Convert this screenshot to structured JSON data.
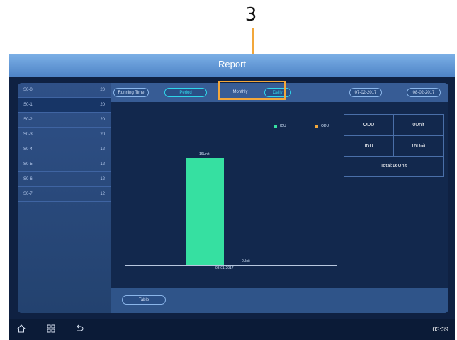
{
  "annotation": {
    "number": "3"
  },
  "header": {
    "title": "Report"
  },
  "sidebar": {
    "items": [
      {
        "name": "S0-0",
        "count": "20",
        "active": false
      },
      {
        "name": "S0-1",
        "count": "20",
        "active": true
      },
      {
        "name": "S0-2",
        "count": "20",
        "active": false
      },
      {
        "name": "S0-3",
        "count": "20",
        "active": false
      },
      {
        "name": "S0-4",
        "count": "12",
        "active": false
      },
      {
        "name": "S0-5",
        "count": "12",
        "active": false
      },
      {
        "name": "S0-6",
        "count": "12",
        "active": false
      },
      {
        "name": "S0-7",
        "count": "12",
        "active": false
      }
    ]
  },
  "filters": {
    "running_time_label": "Running Time",
    "period_value": "Period",
    "monthly_label": "Monthly",
    "monthly_value": "Daily",
    "start_date": "07-02-2017",
    "separator": "~",
    "end_date": "08-02-2017"
  },
  "chart_data": {
    "type": "bar",
    "categories": [
      "08-01-2017"
    ],
    "series": [
      {
        "name": "IDU",
        "values": [
          16
        ],
        "color": "#36e0a1"
      },
      {
        "name": "ODU",
        "values": [
          0
        ],
        "color": "#f2a73b"
      }
    ],
    "data_labels": [
      "16Unit",
      "0Unit"
    ],
    "ylim": [
      0,
      18
    ],
    "legend_position": "top-right"
  },
  "summary": {
    "odu_label": "ODU",
    "odu_value": "0Unit",
    "idu_label": "IDU",
    "idu_value": "16Unit",
    "total": "Total:16Unit"
  },
  "bottom": {
    "table_button": "Table"
  },
  "statusbar": {
    "home_icon": "home-icon",
    "grid_icon": "grid-icon",
    "back_icon": "back-icon",
    "time": "03:39"
  },
  "colors": {
    "accent": "#f2a73b",
    "idu": "#36e0a1",
    "odu": "#f2a73b",
    "chip_cyan": "#2fd6ea"
  }
}
